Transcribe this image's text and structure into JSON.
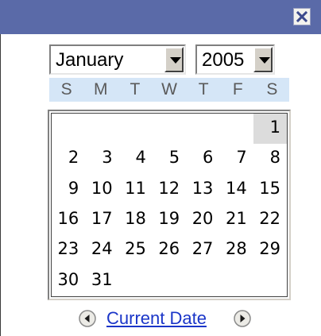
{
  "window": {
    "close_icon": "close-icon"
  },
  "controls": {
    "month": "January",
    "year": "2005"
  },
  "calendar": {
    "weekdays": [
      "S",
      "M",
      "T",
      "W",
      "T",
      "F",
      "S"
    ],
    "selected_day": "1",
    "weeks": [
      [
        "",
        "",
        "",
        "",
        "",
        "",
        "1"
      ],
      [
        "2",
        "3",
        "4",
        "5",
        "6",
        "7",
        "8"
      ],
      [
        "9",
        "10",
        "11",
        "12",
        "13",
        "14",
        "15"
      ],
      [
        "16",
        "17",
        "18",
        "19",
        "20",
        "21",
        "22"
      ],
      [
        "23",
        "24",
        "25",
        "26",
        "27",
        "28",
        "29"
      ],
      [
        "30",
        "31",
        "",
        "",
        "",
        "",
        ""
      ]
    ]
  },
  "footer": {
    "current_date_label": "Current Date",
    "prev_icon": "chevron-left-icon",
    "next_icon": "chevron-right-icon"
  },
  "colors": {
    "titlebar": "#5a6aa8",
    "weekday_band": "#d5e6f7",
    "selected_cell": "#dcdcdc",
    "link": "#1a35c8"
  }
}
